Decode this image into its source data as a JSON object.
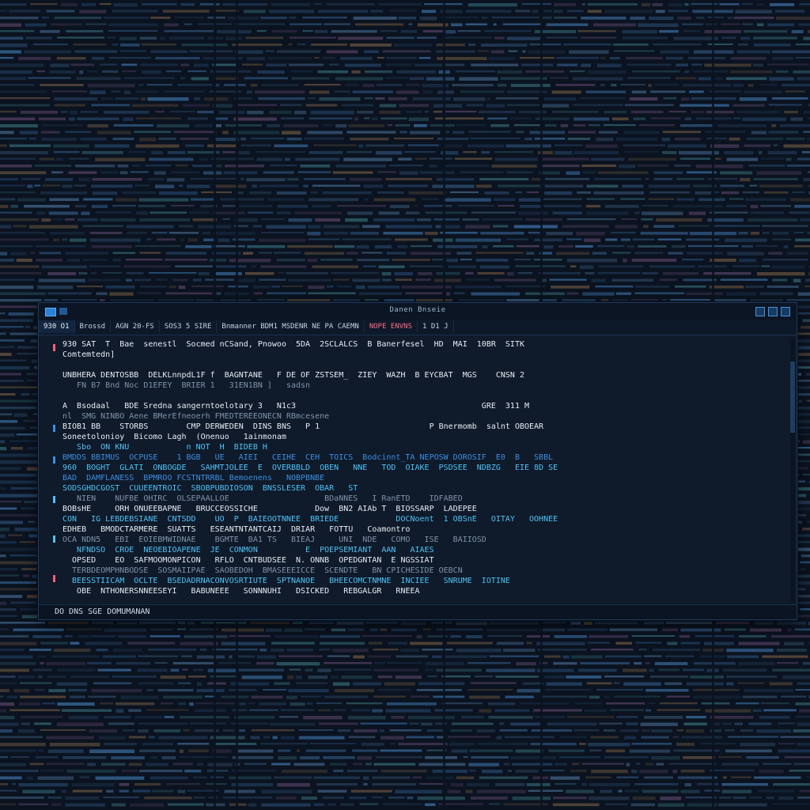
{
  "window": {
    "title": "Danen Bnseie"
  },
  "tabs": [
    {
      "label": "930 O1",
      "active": true
    },
    {
      "label": "Brossd"
    },
    {
      "label": "AGN 20-FS"
    },
    {
      "label": "SOS3 5 SIRE"
    },
    {
      "label": "Bnmanner BDM1 MSDENR NE PA CAEMN"
    },
    {
      "label": "NOPE ENVNS",
      "alert": true
    },
    {
      "label": "1 D1 J"
    }
  ],
  "console": {
    "lines": [
      {
        "text": "930 SAT  T  Bae  senestl  Socmed nCSand, Pnowoo  5DA  2SCLALCS  B Banerfesel  HD  MAI  10BR  SITK",
        "style": "white"
      },
      {
        "text": "Comtemtedn]",
        "style": "white"
      },
      {
        "text": "",
        "style": "dim"
      },
      {
        "text": "UNBHERA DENTOSBB  DELKLnnpdL1F f  BAGNTANE   F DE OF ZSTSEM_  ZIEY  WAZH  B EYCBAT  MGS    CNSN 2",
        "style": "white"
      },
      {
        "text": "   FN B7 Bnd Noc D1EFEY  BRIER 1   31EN1BN ]   sadsn",
        "style": "dim"
      },
      {
        "text": "",
        "style": "dim"
      },
      {
        "text": "A  Bsodaal   BDE Sredna sangerntoelotary 3   N1c3                                       GRE  311 M",
        "style": "white"
      },
      {
        "text": "nl  SMG NINBO Aene BMerEfneoerh FMEDTEREEONECN RBmcesene",
        "style": "dim"
      },
      {
        "text": "BIOB1 BB    STORBS        CMP DERWEDEN  DINS BNS   P 1                       P Bnermomb  salnt OBOEAR",
        "style": "white"
      },
      {
        "text": "Soneetolonioy  Bicomo Lagh  (Onenuo   1ainmonam",
        "style": "white"
      },
      {
        "text": "   Sbo  ON KNU            n NOT  H  BIDEB H",
        "style": "cyan"
      },
      {
        "text": "BMDDS BBIMUS  OCPUSE    1 BGB   UE   AIEI   CEIHE  CEH  TOICS  Bodcinnt_TA NEPOSW DOROSIF  E0  B   SBBL",
        "style": "blue"
      },
      {
        "text": "960  BOGHT  GLATI  ONBOGDE   SAHMTJOLEE  E  OVERBBLD  OBEN   NNE   TOD  OIAKE  PSDSEE  NDBZG   EIE 8D SE",
        "style": "cyan"
      },
      {
        "text": "BAD  DAMFLANESS  BPMROO FCSTNTRRBL Bemoenens   NOBPBNBE",
        "style": "blue"
      },
      {
        "text": "SODSGHDCGOST  CUUEENTROIC  SBOBPUBDIOSON  BNSSLESER  OBAR   ST",
        "style": "cyan"
      },
      {
        "text": "   NIEN    NUFBE OHIRC  OLSEPAALLOE                    BDaNNES   I RanETD    IDFABED",
        "style": "dim"
      },
      {
        "text": "BOBsHE     ORH ONUEEBAPNE   BRUCCEOSSICHE            Dow  BN2 AIAb T  BIOSSARP  LADEPEE",
        "style": "white"
      },
      {
        "text": "CON   IG LEBDEBSIANE  CNTSDD    UO  P  BAIEOOTNNEE  BRIEDE            DOCNoent  1 OBSnE   OITAY   OOHNEE",
        "style": "cyan"
      },
      {
        "text": "EDHEB   BMODCTARMERE  SUATTS   ESEANTNTANTCAIJ  DRIAR   FOTTU   Coamontro",
        "style": "white"
      },
      {
        "text": "OCA NDN5   EBI  EOIEBMWIDNAE    BGMTE  BA1 TS   BIEAJ     UNI  NDE   COMO   ISE   BAIIOSD",
        "style": "dim"
      },
      {
        "text": "   NFNDSO  CROE  NEOEBIOAPENE  JE  CONMON          E  POEPSEMIANT  AAN   AIAES",
        "style": "cyan"
      },
      {
        "text": "  OPSED    EO  SAFMOOMONPICON   RFLO  CNTBUDSEE  N. ONNB  OPEDGNTAN  E NGSSIAT",
        "style": "white"
      },
      {
        "text": "  TERBDEOMPHNBODSE  SOSMAIIPAE  SAOBEDOH  BMASEEEICCE  SCENDTE   BN CPICHESIDE OEBCN",
        "style": "dim"
      },
      {
        "text": "  BEESSTIICAM  OCLTE  BSEDADRNACONVOSRTIUTE  SPTNANOE   BHEECOMCTNMNE  INCIEE   SNRUME  IOTINE",
        "style": "cyan"
      },
      {
        "text": "   OBE  NTHONERSNNEESEYI   BABUNEEE   SONNNUHI   DSICKED   REBGALGR   RNEEA",
        "style": "white"
      }
    ]
  },
  "status": {
    "left": "DO   DNS   SGE    DOMUMANAN",
    "right": ""
  },
  "colors": {
    "accent": "#2b82d6",
    "cyan": "#4fc3f7",
    "alert": "#ff6b8a",
    "background": "#0b1320"
  }
}
